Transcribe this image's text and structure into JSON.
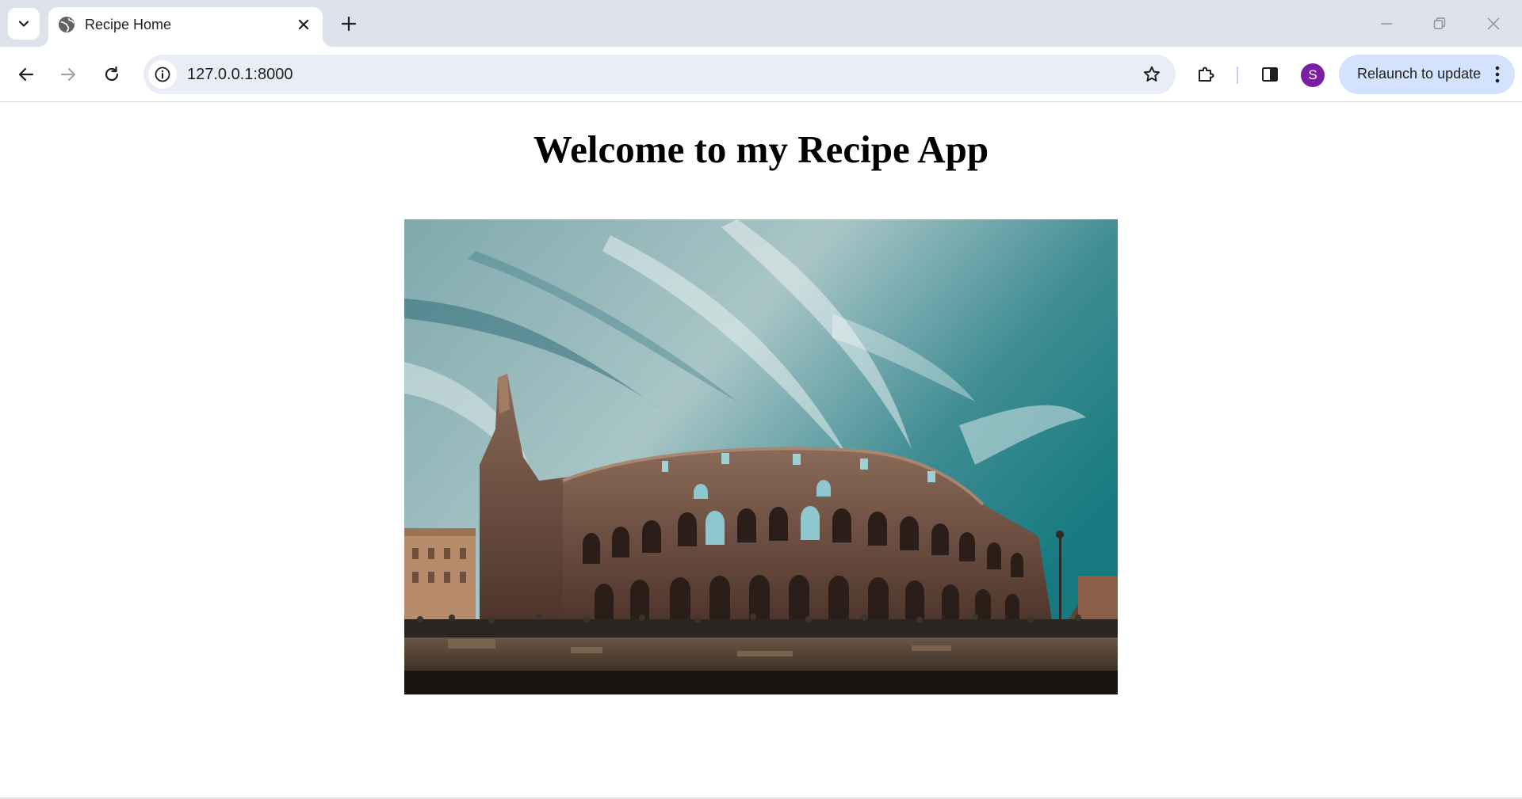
{
  "browser": {
    "tab": {
      "title": "Recipe Home"
    },
    "address_bar": {
      "url": "127.0.0.1:8000"
    },
    "profile": {
      "initial": "S",
      "color": "#7b1fa2"
    },
    "relaunch_button": {
      "label": "Relaunch to update"
    }
  },
  "page": {
    "heading": "Welcome to my Recipe App",
    "hero_image": {
      "subject": "colosseum-photo"
    }
  }
}
